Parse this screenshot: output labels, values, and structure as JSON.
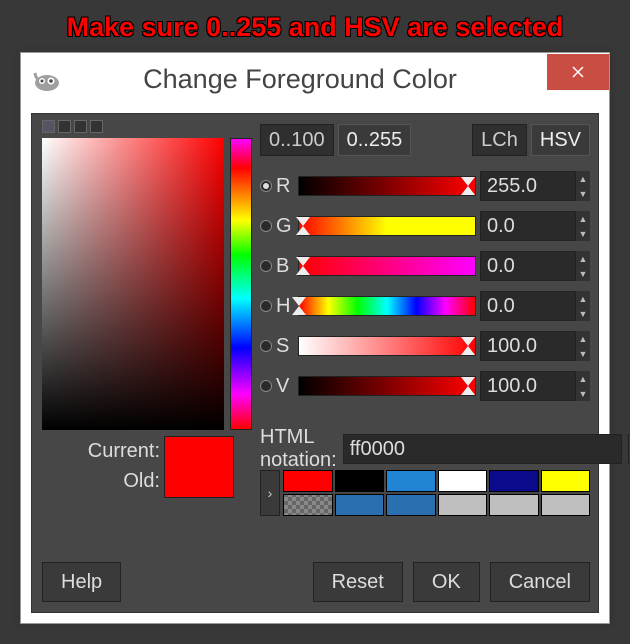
{
  "annotation": "Make sure 0..255 and HSV are selected",
  "window": {
    "title": "Change Foreground Color"
  },
  "range_tabs": {
    "opt1": "0..100",
    "opt2": "0..255",
    "selected": 2
  },
  "model_tabs": {
    "opt1": "LCh",
    "opt2": "HSV",
    "selected": 2
  },
  "channels": {
    "R": {
      "label": "R",
      "value": "255.0",
      "selected": true
    },
    "G": {
      "label": "G",
      "value": "0.0",
      "selected": false
    },
    "B": {
      "label": "B",
      "value": "0.0",
      "selected": false
    },
    "H": {
      "label": "H",
      "value": "0.0",
      "selected": false
    },
    "S": {
      "label": "S",
      "value": "100.0",
      "selected": false
    },
    "V": {
      "label": "V",
      "value": "100.0",
      "selected": false
    }
  },
  "html_notation": {
    "label": "HTML notation:",
    "value": "ff0000"
  },
  "current_old": {
    "current_label": "Current:",
    "old_label": "Old:",
    "color": "#ff0000"
  },
  "swatches_row1": [
    "#ff0000",
    "#000000",
    "#1f85d4",
    "#ffffff",
    "#0a0a8a",
    "#ffff00"
  ],
  "swatches_row2": [
    "#8a8a8a",
    "#2a6fb0",
    "#2a6fb0",
    "#bfbfbf",
    "#bfbfbf",
    "#bfbfbf"
  ],
  "buttons": {
    "help": "Help",
    "reset": "Reset",
    "ok": "OK",
    "cancel": "Cancel"
  },
  "slider_gradients": {
    "R": "linear-gradient(to right,#000,#f00)",
    "G": "linear-gradient(to right,#f00,#ff0,#ff0)",
    "B": "linear-gradient(to right,#f00,#f0f)",
    "H": "linear-gradient(to right,red,yellow,lime,cyan,blue,magenta,red)",
    "S": "linear-gradient(to right,#fff,#f00)",
    "V": "linear-gradient(to right,#000,#f00)"
  },
  "pointer_pos": {
    "R": 96,
    "G": 2,
    "B": 2,
    "H": 0,
    "S": 96,
    "V": 96
  }
}
